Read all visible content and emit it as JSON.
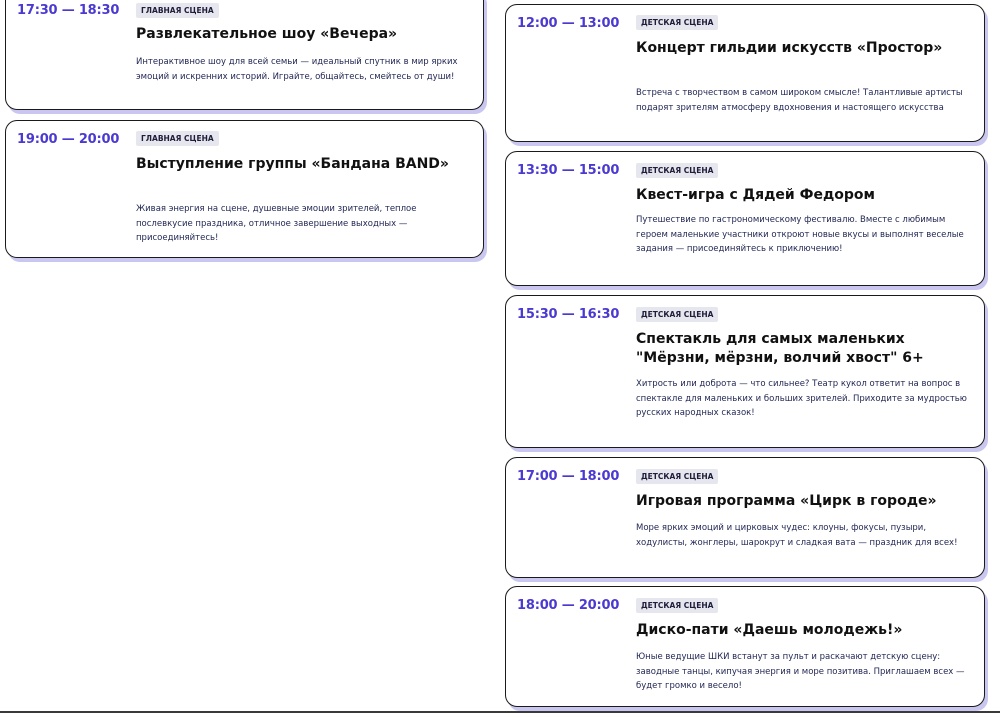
{
  "left_events": [
    {
      "time": "17:30 — 18:30",
      "stage": "главная сцена",
      "title": "Развлекательное шоу «Вечера»",
      "description": "Интерактивное шоу для всей семьи — идеальный спутник в мир ярких эмоций и искренних историй. Играйте, общайтесь, смейтесь от души!"
    },
    {
      "time": "19:00 — 20:00",
      "stage": "главная сцена",
      "title": "Выступление группы «Бандана BAND»",
      "description": "Живая энергия на сцене, душевные эмоции зрителей, теплое послевкусие праздника, отличное завершение выходных — присоединяйтесь!"
    }
  ],
  "right_events": [
    {
      "time": "12:00 — 13:00",
      "stage": "детская сцена",
      "title": "Концерт гильдии искусств «Простор»",
      "description": "Встреча с творчеством в самом широком смысле! Талантливые артисты подарят зрителям атмосферу вдохновения и настоящего искусства"
    },
    {
      "time": "13:30 — 15:00",
      "stage": "детская сцена",
      "title": "Квест-игра с Дядей Федором",
      "description": "Путешествие по гастрономическому фестивалю. Вместе с любимым героем маленькие участники откроют новые вкусы и выполнят веселые задания — присоединяйтесь к приключению!"
    },
    {
      "time": "15:30 — 16:30",
      "stage": "детская сцена",
      "title": "Спектакль для самых маленьких \"Мёрзни, мёрзни, волчий хвост\" 6+",
      "description": "Хитрость или доброта — что сильнее? Театр кукол ответит на вопрос в спектакле для маленьких и больших зрителей. Приходите за мудростью русских народных сказок!"
    },
    {
      "time": "17:00 — 18:00",
      "stage": "детская сцена",
      "title": "Игровая программа «Цирк в городе»",
      "description": "Море ярких эмоций и цирковых чудес: клоуны, фокусы, пузыри, ходулисты, жонглеры, шарокрут и сладкая вата — праздник для всех!"
    },
    {
      "time": "18:00 — 20:00",
      "stage": "детская сцена",
      "title": "Диско-пати «Даешь молодежь!»",
      "description": "Юные ведущие ШКИ встанут за пульт и раскачают детскую сцену: заводные танцы, кипучая энергия и море позитива. Приглашаем всех — будет громко и весело!"
    }
  ]
}
